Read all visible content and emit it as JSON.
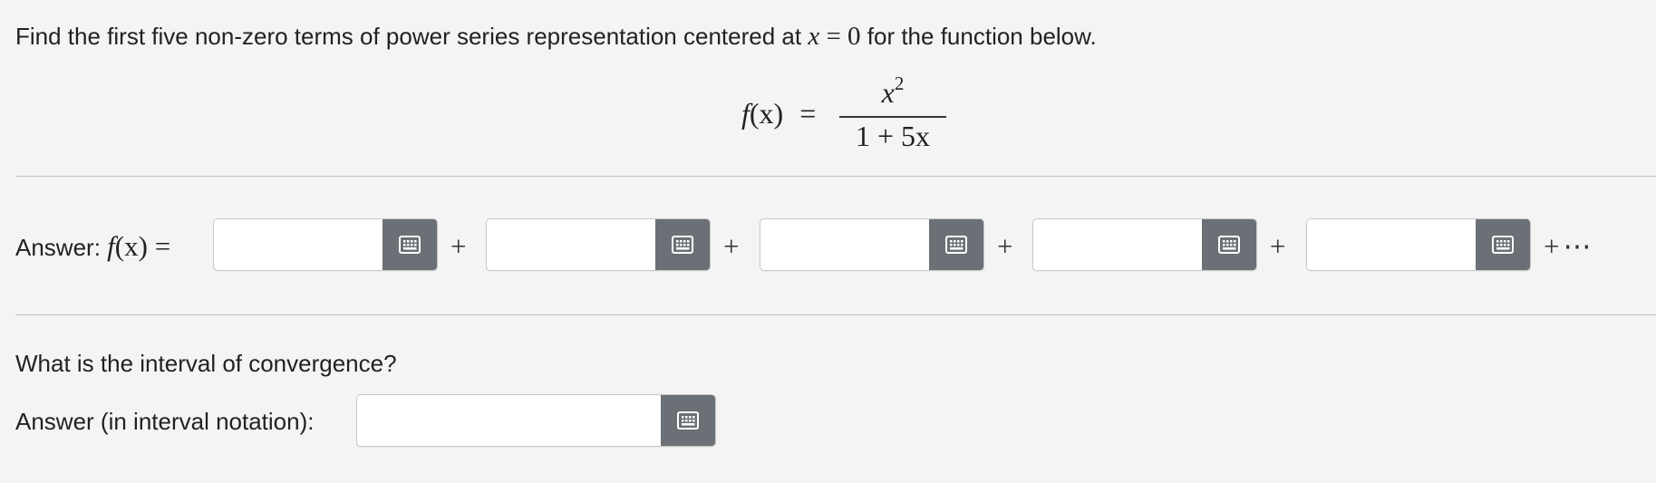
{
  "question": {
    "text_before": "Find the first five non-zero terms of power series representation centered at ",
    "math_var": "x",
    "math_eq": " = 0",
    "text_after": " for the function below."
  },
  "formula": {
    "lhs_f": "f",
    "lhs_arg": "(x)",
    "equals": "=",
    "numerator_base": "x",
    "numerator_exp": "2",
    "denominator": "1 + 5x"
  },
  "answer_series": {
    "label_text": "Answer: ",
    "label_f": "f",
    "label_arg": "(x)",
    "label_eq": " =",
    "terms": [
      {
        "value": "",
        "placeholder": ""
      },
      {
        "value": "",
        "placeholder": ""
      },
      {
        "value": "",
        "placeholder": ""
      },
      {
        "value": "",
        "placeholder": ""
      },
      {
        "value": "",
        "placeholder": ""
      }
    ],
    "plus": "+",
    "trailing": "+⋯",
    "keyboard_icon": "keyboard-grid-icon"
  },
  "convergence": {
    "question": "What is the interval of convergence?",
    "label": "Answer (in interval notation):",
    "value": "",
    "placeholder": ""
  },
  "colors": {
    "background": "#f4f4f4",
    "keyboard_button": "#6b7076",
    "divider": "#c4c4c4"
  }
}
